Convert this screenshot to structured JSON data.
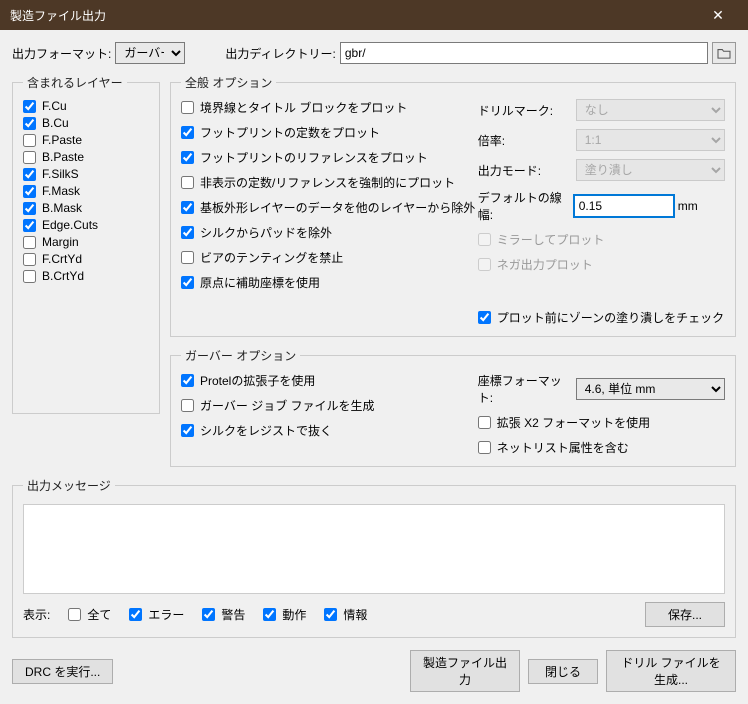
{
  "title": "製造ファイル出力",
  "format": {
    "label": "出力フォーマット:",
    "value": "ガーバー"
  },
  "outdir": {
    "label": "出力ディレクトリー:",
    "value": "gbr/"
  },
  "layers": {
    "legend": "含まれるレイヤー",
    "items": [
      {
        "name": "F.Cu",
        "checked": true
      },
      {
        "name": "B.Cu",
        "checked": true
      },
      {
        "name": "F.Paste",
        "checked": false
      },
      {
        "name": "B.Paste",
        "checked": false
      },
      {
        "name": "F.SilkS",
        "checked": true
      },
      {
        "name": "F.Mask",
        "checked": true
      },
      {
        "name": "B.Mask",
        "checked": true
      },
      {
        "name": "Edge.Cuts",
        "checked": true
      },
      {
        "name": "Margin",
        "checked": false
      },
      {
        "name": "F.CrtYd",
        "checked": false
      },
      {
        "name": "B.CrtYd",
        "checked": false
      }
    ]
  },
  "general": {
    "legend": "全般 オプション",
    "opts": {
      "border_title": {
        "label": "境界線とタイトル ブロックをプロット",
        "checked": false
      },
      "fp_values": {
        "label": "フットプリントの定数をプロット",
        "checked": true
      },
      "fp_refs": {
        "label": "フットプリントのリファレンスをプロット",
        "checked": true
      },
      "force_hidden": {
        "label": "非表示の定数/リファレンスを強制的にプロット",
        "checked": false
      },
      "exclude_edge": {
        "label": "基板外形レイヤーのデータを他のレイヤーから除外",
        "checked": true
      },
      "exclude_pads_silk": {
        "label": "シルクからパッドを除外",
        "checked": true
      },
      "no_via_tent": {
        "label": "ビアのテンティングを禁止",
        "checked": false
      },
      "use_aux_origin": {
        "label": "原点に補助座標を使用",
        "checked": true
      }
    },
    "drill": {
      "label": "ドリルマーク:",
      "value": "なし"
    },
    "scale": {
      "label": "倍率:",
      "value": "1:1"
    },
    "mode": {
      "label": "出力モード:",
      "value": "塗り潰し"
    },
    "linewidth": {
      "label": "デフォルトの線幅:",
      "value": "0.15",
      "unit": "mm"
    },
    "mirror": {
      "label": "ミラーしてプロット",
      "checked": false
    },
    "negative": {
      "label": "ネガ出力プロット",
      "checked": false
    },
    "zone_check": {
      "label": "プロット前にゾーンの塗り潰しをチェック",
      "checked": true
    }
  },
  "gerber": {
    "legend": "ガーバー オプション",
    "protel": {
      "label": "Protelの拡張子を使用",
      "checked": true
    },
    "jobfile": {
      "label": "ガーバー ジョブ ファイルを生成",
      "checked": false
    },
    "subtract_silk": {
      "label": "シルクをレジストで抜く",
      "checked": true
    },
    "coord_fmt": {
      "label": "座標フォーマット:",
      "value": "4.6, 単位 mm"
    },
    "x2": {
      "label": "拡張 X2 フォーマットを使用",
      "checked": false
    },
    "netlist": {
      "label": "ネットリスト属性を含む",
      "checked": false
    }
  },
  "messages": {
    "legend": "出力メッセージ"
  },
  "display": {
    "label": "表示:",
    "all": {
      "label": "全て",
      "checked": false
    },
    "error": {
      "label": "エラー",
      "checked": true
    },
    "warn": {
      "label": "警告",
      "checked": true
    },
    "action": {
      "label": "動作",
      "checked": true
    },
    "info": {
      "label": "情報",
      "checked": true
    },
    "save": "保存..."
  },
  "footer": {
    "drc": "DRC を実行...",
    "plot": "製造ファイル出力",
    "close": "閉じる",
    "drill": "ドリル ファイルを生成..."
  }
}
